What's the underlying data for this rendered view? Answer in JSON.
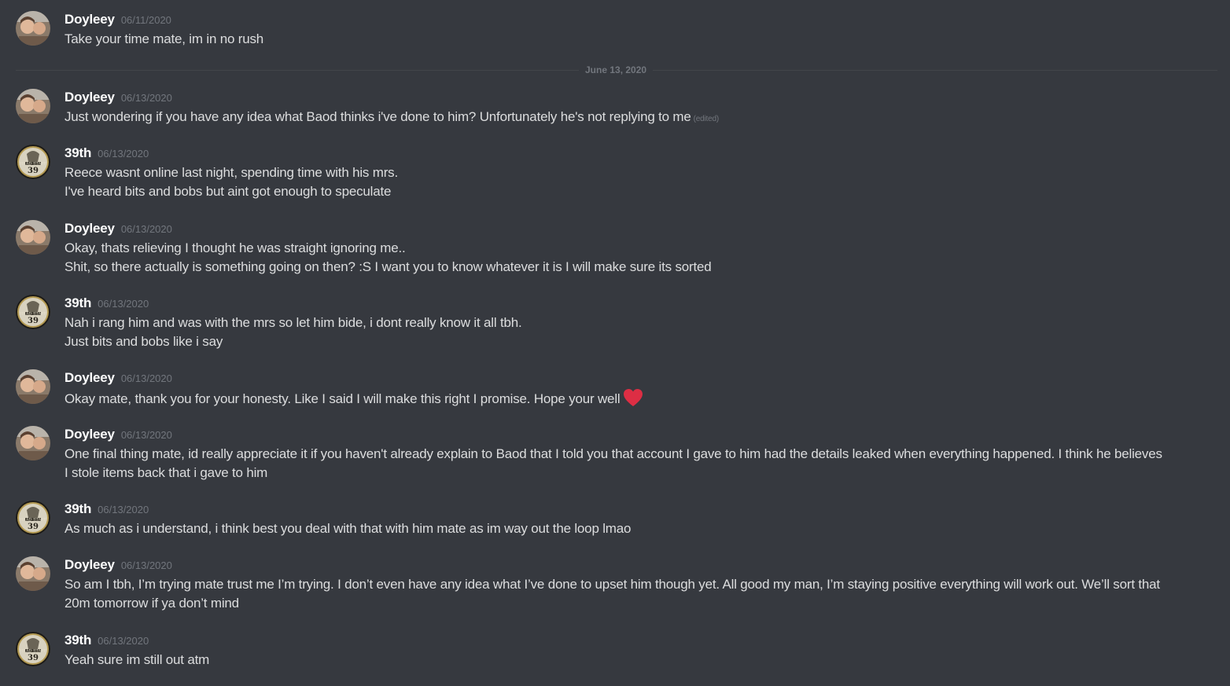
{
  "divider": {
    "label": "June 13, 2020"
  },
  "messages": [
    {
      "author": "Doyleey",
      "timestamp": "06/11/2020",
      "lines": [
        "Take your time mate, im in no rush"
      ]
    },
    {
      "author": "Doyleey",
      "timestamp": "06/13/2020",
      "lines": [
        "Just wondering if you have any idea what Baod thinks i've done to him? Unfortunately he's not replying to me"
      ],
      "edited_label": "(edited)"
    },
    {
      "author": "39th",
      "timestamp": "06/13/2020",
      "lines": [
        "Reece wasnt online last night, spending time with his mrs.",
        "I've heard bits and bobs but aint got enough to speculate"
      ]
    },
    {
      "author": "Doyleey",
      "timestamp": "06/13/2020",
      "lines": [
        "Okay, thats relieving I thought he was straight ignoring me..",
        "Shit, so there actually is something going on then? :S I want you to know whatever it is I will make sure its sorted"
      ]
    },
    {
      "author": "39th",
      "timestamp": "06/13/2020",
      "lines": [
        "Nah i rang him and was with the mrs so let him bide, i dont really know it all tbh.",
        "Just bits and bobs like i say"
      ]
    },
    {
      "author": "Doyleey",
      "timestamp": "06/13/2020",
      "lines": [
        "Okay mate, thank you for your honesty. Like I said I will make this right I promise. Hope your well"
      ],
      "emoji": "heart-emoji"
    },
    {
      "author": "Doyleey",
      "timestamp": "06/13/2020",
      "lines": [
        "One final thing mate, id really appreciate it if you haven't already explain to Baod that I told you that account I gave to him had the details leaked when everything happened. I think he believes I stole items back that i gave to him"
      ]
    },
    {
      "author": "39th",
      "timestamp": "06/13/2020",
      "lines": [
        "As much as i understand, i think best you deal with that with him mate as im way out the loop lmao"
      ]
    },
    {
      "author": "Doyleey",
      "timestamp": "06/13/2020",
      "lines": [
        "So am I tbh, I’m trying mate trust me I’m trying. I don’t even have any idea what I’ve done to upset him though yet. All good my man, I’m staying positive everything will work out. We’ll sort that 20m tomorrow if ya don’t mind"
      ]
    },
    {
      "author": "39th",
      "timestamp": "06/13/2020",
      "lines": [
        "Yeah sure im still out atm"
      ]
    }
  ],
  "avatar_badge": {
    "text_top": "HEAD STAFF",
    "text_num": "39"
  },
  "colors": {
    "background": "#36393f",
    "username": "#ffffff",
    "text": "#dcddde",
    "muted": "#72767d",
    "heart": "#dd2e44"
  }
}
